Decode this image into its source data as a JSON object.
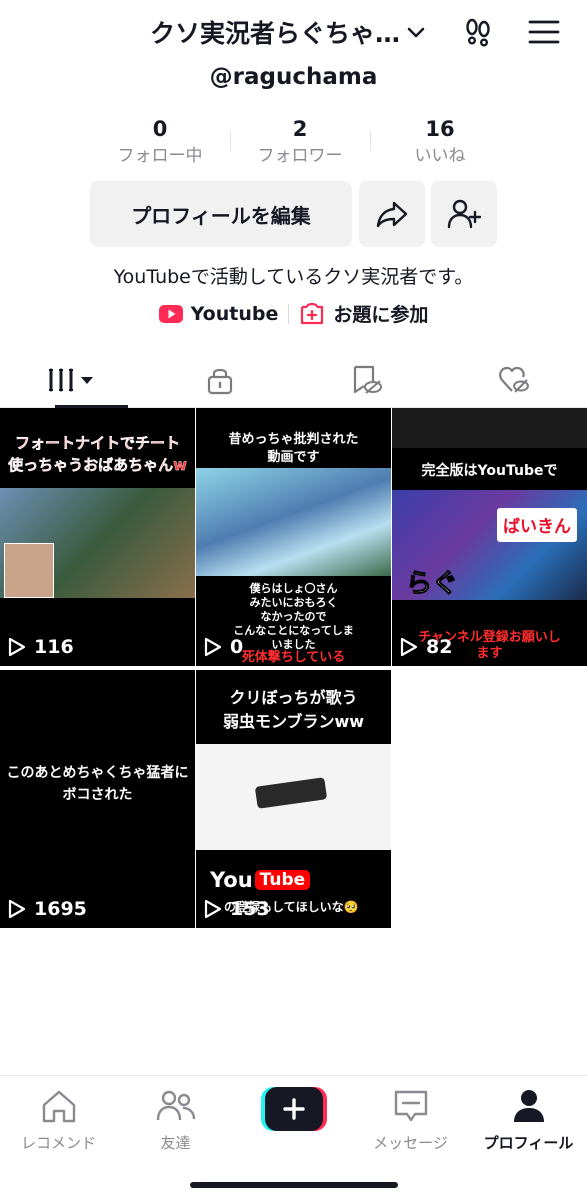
{
  "header": {
    "title": "クソ実況者らぐちゃ…",
    "username": "@raguchama"
  },
  "stats": [
    {
      "value": "0",
      "label": "フォロー中"
    },
    {
      "value": "2",
      "label": "フォロワー"
    },
    {
      "value": "16",
      "label": "いいね"
    }
  ],
  "actions": {
    "edit_label": "プロフィールを編集"
  },
  "bio": "YouTubeで活動しているクソ実況者です。",
  "links": {
    "youtube": "Youtube",
    "topic": "お題に参加"
  },
  "videos": [
    {
      "views": "116",
      "caption_top": "フォートナイトでチート",
      "caption_bottom": "使っちゃうおばあちゃんw"
    },
    {
      "views": "0",
      "caption_top": "昔めっちゃ批判された",
      "caption_bottom": "動画です",
      "caption_lower": "僕らはしょ〇さん\nみたいにおもろく\nなかったので\nこんなことになってしま\nいました",
      "caption_red": "死体撃ちしている"
    },
    {
      "views": "82",
      "caption_top": "完全版はYouTubeで",
      "caption_mid": "ばいきん",
      "caption_mid2": "らぐ",
      "caption_red": "チャンネル登録お願いし\nます"
    },
    {
      "views": "1695",
      "caption_top": "このあとめちゃくちゃ猛者に\nボコされた"
    },
    {
      "views": "153",
      "caption_top": "クリぼっちが歌う\n弱虫モンブランww",
      "caption_yt1": "You",
      "caption_yt2": "Tube",
      "caption_bottom": "の登録もしてほしいな🥺"
    }
  ],
  "nav": [
    {
      "label": "レコメンド",
      "icon": "home-icon"
    },
    {
      "label": "友達",
      "icon": "friends-icon"
    },
    {
      "label": "",
      "icon": "plus-icon"
    },
    {
      "label": "メッセージ",
      "icon": "inbox-icon"
    },
    {
      "label": "プロフィール",
      "icon": "profile-icon"
    }
  ],
  "colors": {
    "text": "#161823",
    "muted": "#8a8b91",
    "button_bg": "#f1f1f2",
    "accent_red": "#fe2c55",
    "accent_cyan": "#25f4ee",
    "youtube_red": "#ff0000"
  }
}
